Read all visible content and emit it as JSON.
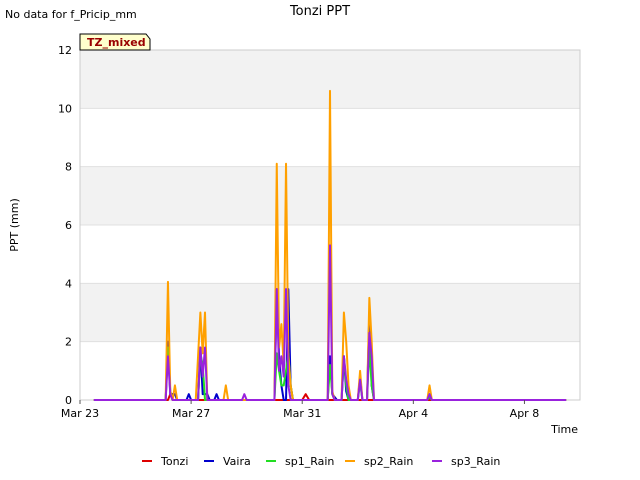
{
  "header": {
    "note": "No data for f_Pricip_mm",
    "tz_label": "TZ_mixed"
  },
  "chart_data": {
    "type": "line",
    "title": "Tonzi PPT",
    "xlabel": "Time",
    "ylabel": "PPT (mm)",
    "x_range": [
      "2025-03-23",
      "2025-04-10"
    ],
    "ylim": [
      0,
      12
    ],
    "y_ticks": [
      0,
      2,
      4,
      6,
      8,
      10,
      12
    ],
    "x_ticks": [
      {
        "date": "2025-03-23",
        "label": "Mar 23"
      },
      {
        "date": "2025-03-27",
        "label": "Mar 27"
      },
      {
        "date": "2025-03-31",
        "label": "Mar 31"
      },
      {
        "date": "2025-04-04",
        "label": "Apr 4"
      },
      {
        "date": "2025-04-08",
        "label": "Apr 8"
      }
    ],
    "grid": true,
    "legend_position": "bottom",
    "series": [
      {
        "name": "Tonzi",
        "color": "#dd0000",
        "points": [
          [
            "2025-03-23 12:00",
            0
          ],
          [
            "2025-03-26 04:00",
            0
          ],
          [
            "2025-03-26 06:00",
            0.2
          ],
          [
            "2025-03-26 08:00",
            0
          ],
          [
            "2025-03-31 00:00",
            0
          ],
          [
            "2025-03-31 03:00",
            0.2
          ],
          [
            "2025-03-31 06:00",
            0
          ],
          [
            "2025-04-09 12:00",
            0
          ]
        ]
      },
      {
        "name": "Vaira",
        "color": "#0000cc",
        "points": [
          [
            "2025-03-23 12:00",
            0
          ],
          [
            "2025-03-26 02:00",
            0
          ],
          [
            "2025-03-26 04:00",
            2.0
          ],
          [
            "2025-03-26 06:00",
            0.2
          ],
          [
            "2025-03-26 10:00",
            0.2
          ],
          [
            "2025-03-26 12:00",
            0
          ],
          [
            "2025-03-26 20:00",
            0
          ],
          [
            "2025-03-26 22:00",
            0.2
          ],
          [
            "2025-03-27 00:00",
            0
          ],
          [
            "2025-03-27 06:00",
            0
          ],
          [
            "2025-03-27 08:00",
            1.8
          ],
          [
            "2025-03-27 10:00",
            0.2
          ],
          [
            "2025-03-27 14:00",
            0.2
          ],
          [
            "2025-03-27 16:00",
            0
          ],
          [
            "2025-03-27 20:00",
            0
          ],
          [
            "2025-03-27 22:00",
            0.2
          ],
          [
            "2025-03-28 00:00",
            0
          ],
          [
            "2025-03-30 00:00",
            0
          ],
          [
            "2025-03-30 02:00",
            3.8
          ],
          [
            "2025-03-30 04:00",
            1.5
          ],
          [
            "2025-03-30 06:00",
            0.5
          ],
          [
            "2025-03-30 08:00",
            0
          ],
          [
            "2025-03-30 10:00",
            0
          ],
          [
            "2025-03-30 12:00",
            3.8
          ],
          [
            "2025-03-30 14:00",
            0.5
          ],
          [
            "2025-03-30 16:00",
            0
          ],
          [
            "2025-03-31 22:00",
            0
          ],
          [
            "2025-04-01 00:00",
            1.5
          ],
          [
            "2025-04-01 02:00",
            0.2
          ],
          [
            "2025-04-01 06:00",
            0
          ],
          [
            "2025-04-01 10:00",
            0
          ],
          [
            "2025-04-01 12:00",
            1.5
          ],
          [
            "2025-04-01 14:00",
            0.3
          ],
          [
            "2025-04-01 16:00",
            0
          ],
          [
            "2025-04-02 00:00",
            0
          ],
          [
            "2025-04-02 02:00",
            0.8
          ],
          [
            "2025-04-02 04:00",
            0
          ],
          [
            "2025-04-02 08:00",
            0
          ],
          [
            "2025-04-02 10:00",
            3.0
          ],
          [
            "2025-04-02 12:00",
            0.5
          ],
          [
            "2025-04-02 14:00",
            0
          ],
          [
            "2025-04-04 12:00",
            0
          ],
          [
            "2025-04-04 14:00",
            0.2
          ],
          [
            "2025-04-04 16:00",
            0
          ],
          [
            "2025-04-09 12:00",
            0
          ]
        ]
      },
      {
        "name": "sp1_Rain",
        "color": "#22dd22",
        "points": [
          [
            "2025-03-23 12:00",
            0
          ],
          [
            "2025-03-26 02:00",
            0
          ],
          [
            "2025-03-26 04:00",
            1.8
          ],
          [
            "2025-03-26 06:00",
            0.3
          ],
          [
            "2025-03-26 08:00",
            0
          ],
          [
            "2025-03-27 06:00",
            0
          ],
          [
            "2025-03-27 08:00",
            1.6
          ],
          [
            "2025-03-27 10:00",
            1.2
          ],
          [
            "2025-03-27 12:00",
            0
          ],
          [
            "2025-03-30 00:00",
            0
          ],
          [
            "2025-03-30 02:00",
            1.6
          ],
          [
            "2025-03-30 04:00",
            1.0
          ],
          [
            "2025-03-30 06:00",
            0.5
          ],
          [
            "2025-03-30 08:00",
            0.5
          ],
          [
            "2025-03-30 10:00",
            1.0
          ],
          [
            "2025-03-30 12:00",
            1.6
          ],
          [
            "2025-03-30 14:00",
            0.5
          ],
          [
            "2025-03-30 16:00",
            0
          ],
          [
            "2025-03-31 22:00",
            0
          ],
          [
            "2025-04-01 00:00",
            1.2
          ],
          [
            "2025-04-01 02:00",
            0.2
          ],
          [
            "2025-04-01 04:00",
            0
          ],
          [
            "2025-04-01 10:00",
            0
          ],
          [
            "2025-04-01 12:00",
            1.5
          ],
          [
            "2025-04-01 14:00",
            0.5
          ],
          [
            "2025-04-01 16:00",
            0
          ],
          [
            "2025-04-02 00:00",
            0
          ],
          [
            "2025-04-02 02:00",
            0.6
          ],
          [
            "2025-04-02 04:00",
            0
          ],
          [
            "2025-04-02 08:00",
            0
          ],
          [
            "2025-04-02 10:00",
            1.8
          ],
          [
            "2025-04-02 12:00",
            0.5
          ],
          [
            "2025-04-02 14:00",
            0
          ],
          [
            "2025-04-04 12:00",
            0
          ],
          [
            "2025-04-04 14:00",
            0.1
          ],
          [
            "2025-04-04 16:00",
            0
          ],
          [
            "2025-04-09 12:00",
            0
          ]
        ]
      },
      {
        "name": "sp2_Rain",
        "color": "#ffa000",
        "points": [
          [
            "2025-03-23 12:00",
            0
          ],
          [
            "2025-03-26 02:00",
            0
          ],
          [
            "2025-03-26 04:00",
            4.05
          ],
          [
            "2025-03-26 06:00",
            0.3
          ],
          [
            "2025-03-26 08:00",
            0
          ],
          [
            "2025-03-26 10:00",
            0.5
          ],
          [
            "2025-03-26 12:00",
            0
          ],
          [
            "2025-03-27 04:00",
            0
          ],
          [
            "2025-03-27 06:00",
            1.5
          ],
          [
            "2025-03-27 08:00",
            3.0
          ],
          [
            "2025-03-27 10:00",
            1.6
          ],
          [
            "2025-03-27 12:00",
            3.0
          ],
          [
            "2025-03-27 14:00",
            0
          ],
          [
            "2025-03-28 04:00",
            0
          ],
          [
            "2025-03-28 06:00",
            0.5
          ],
          [
            "2025-03-28 08:00",
            0
          ],
          [
            "2025-03-30 00:00",
            0
          ],
          [
            "2025-03-30 02:00",
            8.1
          ],
          [
            "2025-03-30 04:00",
            1.8
          ],
          [
            "2025-03-30 06:00",
            2.6
          ],
          [
            "2025-03-30 08:00",
            1.2
          ],
          [
            "2025-03-30 10:00",
            8.1
          ],
          [
            "2025-03-30 12:00",
            1.5
          ],
          [
            "2025-03-30 14:00",
            0.5
          ],
          [
            "2025-03-30 16:00",
            0
          ],
          [
            "2025-03-31 22:00",
            0
          ],
          [
            "2025-04-01 00:00",
            10.6
          ],
          [
            "2025-04-01 02:00",
            0.3
          ],
          [
            "2025-04-01 04:00",
            0
          ],
          [
            "2025-04-01 10:00",
            0
          ],
          [
            "2025-04-01 12:00",
            3.0
          ],
          [
            "2025-04-01 14:00",
            2.0
          ],
          [
            "2025-04-01 16:00",
            0.5
          ],
          [
            "2025-04-01 18:00",
            0
          ],
          [
            "2025-04-02 00:00",
            0
          ],
          [
            "2025-04-02 02:00",
            1.0
          ],
          [
            "2025-04-02 04:00",
            0
          ],
          [
            "2025-04-02 08:00",
            0
          ],
          [
            "2025-04-02 10:00",
            3.5
          ],
          [
            "2025-04-02 12:00",
            2.0
          ],
          [
            "2025-04-02 14:00",
            0
          ],
          [
            "2025-04-04 12:00",
            0
          ],
          [
            "2025-04-04 14:00",
            0.5
          ],
          [
            "2025-04-04 16:00",
            0
          ],
          [
            "2025-04-09 12:00",
            0
          ]
        ]
      },
      {
        "name": "sp3_Rain",
        "color": "#9922dd",
        "points": [
          [
            "2025-03-23 12:00",
            0
          ],
          [
            "2025-03-26 02:00",
            0
          ],
          [
            "2025-03-26 04:00",
            1.5
          ],
          [
            "2025-03-26 06:00",
            0.2
          ],
          [
            "2025-03-26 08:00",
            0
          ],
          [
            "2025-03-27 06:00",
            0
          ],
          [
            "2025-03-27 08:00",
            1.8
          ],
          [
            "2025-03-27 10:00",
            0.8
          ],
          [
            "2025-03-27 12:00",
            1.8
          ],
          [
            "2025-03-27 14:00",
            0
          ],
          [
            "2025-03-28 20:00",
            0
          ],
          [
            "2025-03-28 22:00",
            0.2
          ],
          [
            "2025-03-29 00:00",
            0
          ],
          [
            "2025-03-30 00:00",
            0
          ],
          [
            "2025-03-30 02:00",
            3.8
          ],
          [
            "2025-03-30 04:00",
            1.0
          ],
          [
            "2025-03-30 06:00",
            1.5
          ],
          [
            "2025-03-30 08:00",
            0.8
          ],
          [
            "2025-03-30 10:00",
            3.8
          ],
          [
            "2025-03-30 12:00",
            0.5
          ],
          [
            "2025-03-30 14:00",
            0
          ],
          [
            "2025-03-31 22:00",
            0
          ],
          [
            "2025-04-01 00:00",
            5.3
          ],
          [
            "2025-04-01 02:00",
            0.2
          ],
          [
            "2025-04-01 04:00",
            0
          ],
          [
            "2025-04-01 10:00",
            0
          ],
          [
            "2025-04-01 12:00",
            1.5
          ],
          [
            "2025-04-01 14:00",
            0.7
          ],
          [
            "2025-04-01 16:00",
            0.2
          ],
          [
            "2025-04-01 18:00",
            0
          ],
          [
            "2025-04-02 00:00",
            0
          ],
          [
            "2025-04-02 02:00",
            0.7
          ],
          [
            "2025-04-02 04:00",
            0
          ],
          [
            "2025-04-02 08:00",
            0
          ],
          [
            "2025-04-02 10:00",
            2.3
          ],
          [
            "2025-04-02 12:00",
            1.5
          ],
          [
            "2025-04-02 14:00",
            0
          ],
          [
            "2025-04-04 12:00",
            0
          ],
          [
            "2025-04-04 14:00",
            0.2
          ],
          [
            "2025-04-04 16:00",
            0
          ],
          [
            "2025-04-09 12:00",
            0
          ]
        ]
      }
    ]
  }
}
